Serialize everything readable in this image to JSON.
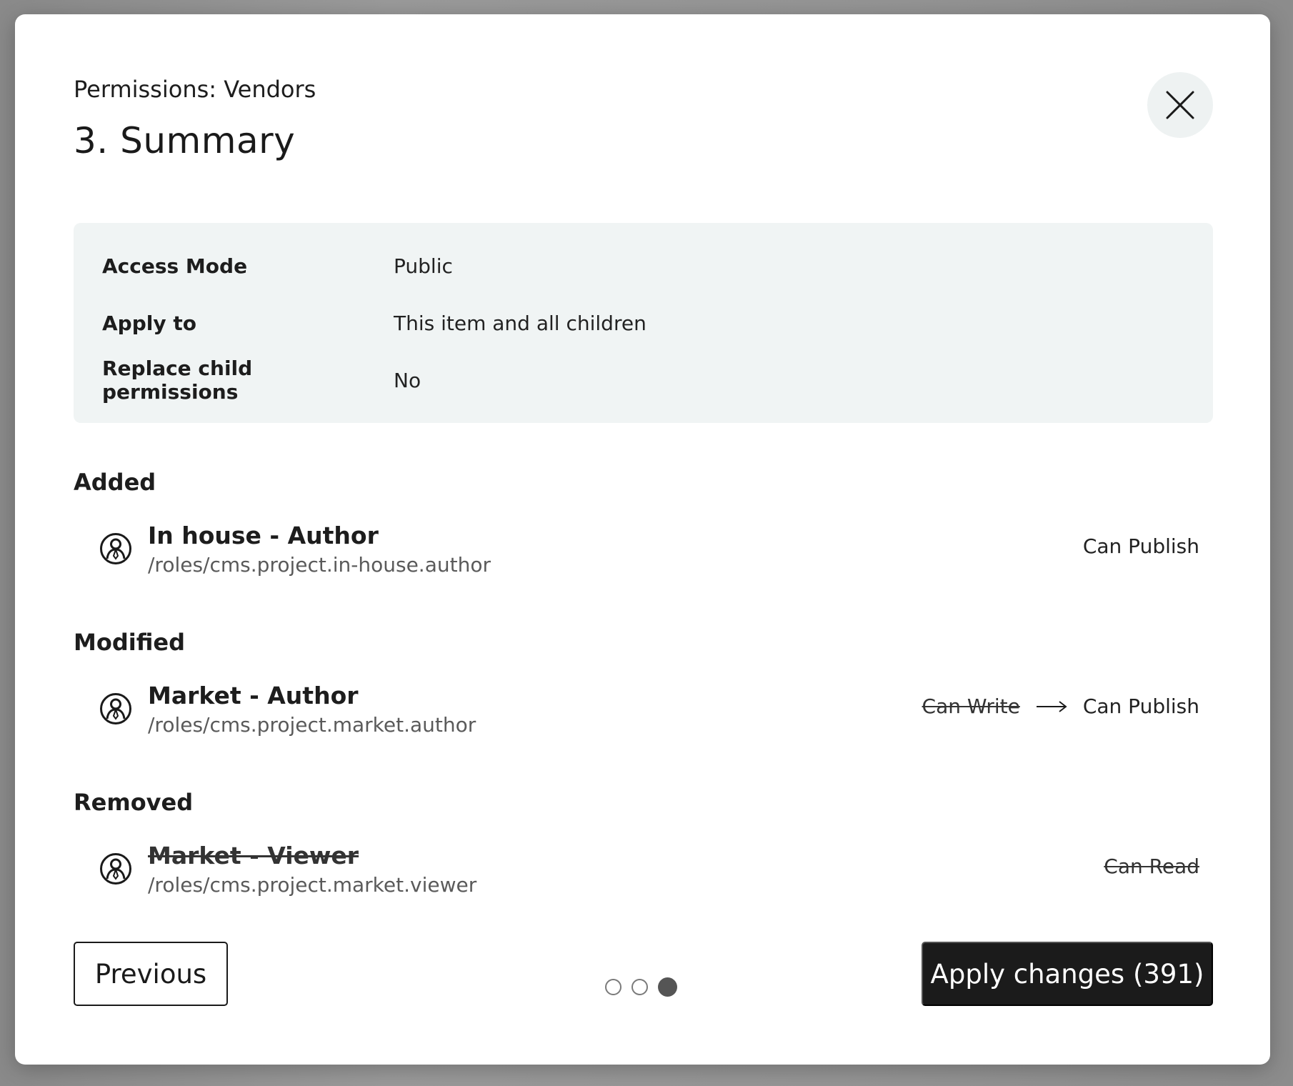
{
  "modal": {
    "subtitle": "Permissions: Vendors",
    "title": "3. Summary",
    "close_icon": "close-icon"
  },
  "summary": {
    "rows": [
      {
        "label": "Access Mode",
        "value": "Public"
      },
      {
        "label": "Apply to",
        "value": "This item and all children"
      },
      {
        "label": "Replace child permissions",
        "value": "No"
      }
    ]
  },
  "sections": {
    "added": {
      "heading": "Added",
      "role": {
        "name": "In house - Author",
        "path": "/roles/cms.project.in-house.author",
        "permission": "Can Publish",
        "icon": "user-role-icon"
      }
    },
    "modified": {
      "heading": "Modified",
      "role": {
        "name": "Market - Author",
        "path": "/roles/cms.project.market.author",
        "old_permission": "Can Write",
        "new_permission": "Can Publish",
        "icon": "user-role-icon"
      }
    },
    "removed": {
      "heading": "Removed",
      "role": {
        "name": "Market - Viewer",
        "path": "/roles/cms.project.market.viewer",
        "permission": "Can Read",
        "icon": "user-role-icon"
      }
    }
  },
  "footer": {
    "previous_label": "Previous",
    "apply_label": "Apply changes (391)",
    "step_total": 3,
    "step_current": 3
  },
  "colors": {
    "primary_button": "#1b1b1b",
    "summary_background": "#f0f4f4",
    "close_background": "#eef2f2"
  }
}
